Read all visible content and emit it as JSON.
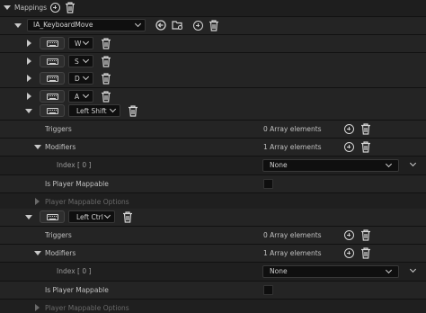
{
  "mappings": {
    "label": "Mappings",
    "action_asset": "IA_KeyboardMove",
    "simple_keys": [
      {
        "key": "W"
      },
      {
        "key": "S"
      },
      {
        "key": "D"
      },
      {
        "key": "A"
      }
    ],
    "expanded": [
      {
        "key": "Left Shift",
        "triggers_label": "Triggers",
        "triggers_value": "0 Array elements",
        "modifiers_label": "Modifiers",
        "modifiers_value": "1 Array elements",
        "index_label": "Index [ 0 ]",
        "index_value": "None",
        "player_mappable_label": "Is Player Mappable",
        "player_mappable_options_label": "Player Mappable Options"
      },
      {
        "key": "Left Ctrl",
        "triggers_label": "Triggers",
        "triggers_value": "0 Array elements",
        "modifiers_label": "Modifiers",
        "modifiers_value": "1 Array elements",
        "index_label": "Index [ 0 ]",
        "index_value": "None",
        "player_mappable_label": "Is Player Mappable",
        "player_mappable_options_label": "Player Mappable Options"
      }
    ]
  },
  "icons": {
    "add": "plus-circle-icon",
    "delete": "trash-icon",
    "browse": "arrow-left-circle-icon",
    "find_asset": "browse-folder-icon",
    "keyboard": "keyboard-icon"
  },
  "colors": {
    "row_bg": "#242424",
    "row_alt_bg": "#1f1f1f",
    "text": "#c0c0c0",
    "dim_text": "#6a6a6a"
  }
}
